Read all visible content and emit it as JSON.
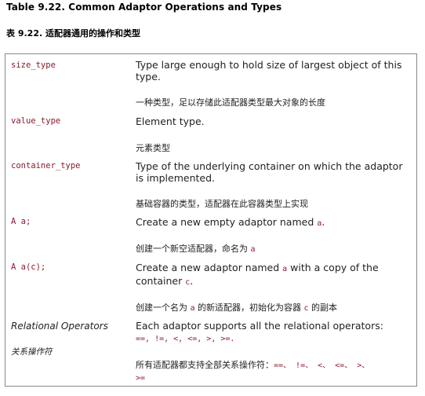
{
  "title_en": "Table 9.22. Common Adaptor Operations and Types",
  "title_cn": "表 9.22. 适配器通用的操作和类型",
  "rows": [
    {
      "term": "size_type",
      "desc": "Type large enough to hold size of largest object of this type.",
      "desc_cn": "一种类型，足以存储此适配器类型最大对象的长度"
    },
    {
      "term": "value_type",
      "desc": "Element type.",
      "desc_cn": "元素类型"
    },
    {
      "term": "container_type",
      "desc": "Type of the underlying container on which the adaptor is implemented.",
      "desc_cn": "基础容器的类型，适配器在此容器类型上实现"
    },
    {
      "term": "A a;",
      "desc_pre": "Create a new empty adaptor named ",
      "desc_code": "a",
      "desc_post": ".",
      "desc_cn_pre": "创建一个新空适配器，命名为 ",
      "desc_cn_code": "a"
    },
    {
      "term": "A a(c);",
      "desc_pre": "Create a new adaptor named ",
      "desc_code": "a",
      "desc_mid": " with a copy of the container ",
      "desc_code2": "c",
      "desc_post": ".",
      "desc_cn_pre": "创建一个名为 ",
      "desc_cn_code": "a",
      "desc_cn_mid": " 的新适配器，初始化为容器 ",
      "desc_cn_code2": "c",
      "desc_cn_post": " 的副本"
    },
    {
      "term": "Relational Operators",
      "term_cn": "关系操作符",
      "desc": "Each adaptor supports all the relational operators:",
      "desc_ops": "==,  !=,  <,  <=,  >,  >=.",
      "desc_cn_pre": "所有适配器都支持全部关系操作符：",
      "desc_cn_ops": "==、 !=、 <、 <=、 >、",
      "desc_cn_ops2": ">="
    }
  ]
}
